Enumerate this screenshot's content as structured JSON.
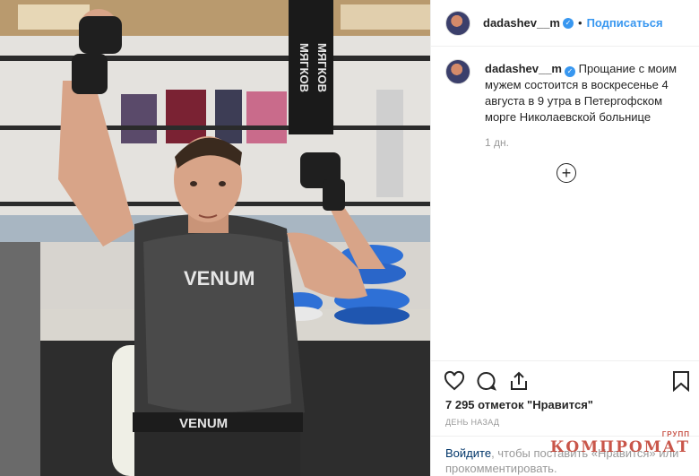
{
  "header": {
    "username": "dadashev__m",
    "separator": "•",
    "follow_label": "Подписаться"
  },
  "caption": {
    "username": "dadashev__m",
    "text": "Прощание с моим мужем состоится в воскресенье 4 августа в 9 утра в Петергофском морге Николаевской больнице",
    "time": "1 дн."
  },
  "load_more_icon": "plus-circle-icon",
  "actions": {
    "icons": [
      "heart-icon",
      "comment-icon",
      "share-icon",
      "bookmark-icon"
    ]
  },
  "likes": "7 295 отметок \"Нравится\"",
  "posted_ago": "день назад",
  "add_comment": {
    "login_link": "Войдите",
    "text": ", чтобы поставить «Нравится» или прокомментировать."
  },
  "photo": {
    "banner_left": "МЯГКОВ",
    "banner_right": "МЯГКОВ",
    "shirt_brand": "VENUM",
    "waistband_brand": "VENUM"
  },
  "watermark": {
    "text": "КОМПРОМАТ",
    "sup": "ГРУПП"
  },
  "colors": {
    "accent": "#3897f0",
    "link_dark": "#003569",
    "muted": "#999999",
    "watermark": "#c0392b"
  }
}
